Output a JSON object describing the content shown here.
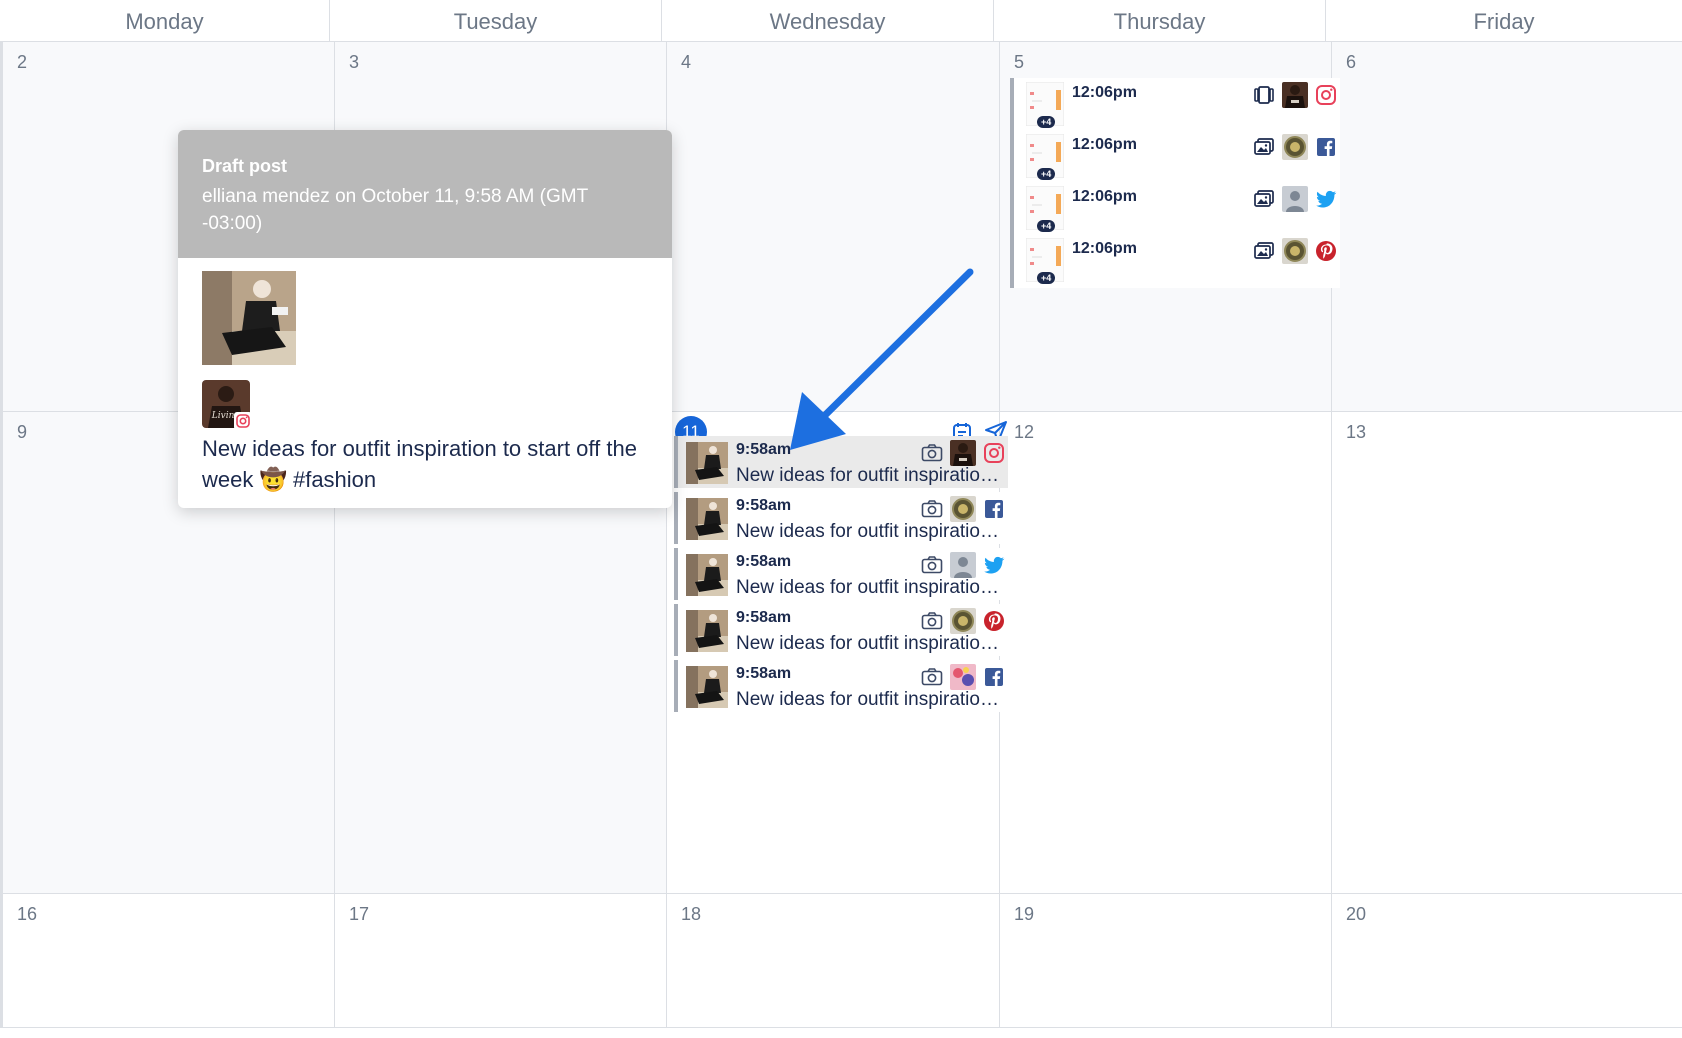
{
  "weekdays": [
    "Monday",
    "Tuesday",
    "Wednesday",
    "Thursday",
    "Friday"
  ],
  "weeks": [
    {
      "days": [
        "2",
        "3",
        "4",
        "5",
        "6"
      ]
    },
    {
      "days": [
        "9",
        "",
        "",
        "12",
        "13"
      ]
    },
    {
      "days": [
        "16",
        "17",
        "18",
        "19",
        "20"
      ]
    }
  ],
  "today": "11",
  "thursday_events": [
    {
      "time": "12:06pm",
      "badge": "+4",
      "format_icon": "carousel-icon",
      "network": "instagram"
    },
    {
      "time": "12:06pm",
      "badge": "+4",
      "format_icon": "gallery-icon",
      "network": "facebook"
    },
    {
      "time": "12:06pm",
      "badge": "+4",
      "format_icon": "gallery-icon",
      "network": "twitter"
    },
    {
      "time": "12:06pm",
      "badge": "+4",
      "format_icon": "gallery-icon",
      "network": "pinterest"
    }
  ],
  "wednesday_events": [
    {
      "time": "9:58am",
      "text": "New ideas for outfit inspiratio…",
      "format_icon": "camera-icon",
      "network": "instagram"
    },
    {
      "time": "9:58am",
      "text": "New ideas for outfit inspiratio…",
      "format_icon": "camera-icon",
      "network": "facebook"
    },
    {
      "time": "9:58am",
      "text": "New ideas for outfit inspiratio…",
      "format_icon": "camera-icon",
      "network": "twitter"
    },
    {
      "time": "9:58am",
      "text": "New ideas for outfit inspiratio…",
      "format_icon": "camera-icon",
      "network": "pinterest"
    },
    {
      "time": "9:58am",
      "text": "New ideas for outfit inspiratio…",
      "format_icon": "camera-icon",
      "network": "facebook"
    }
  ],
  "popover": {
    "title": "Draft post",
    "subtitle": "elliana mendez on October 11, 9:58 AM (GMT -03:00)",
    "text": "New ideas for outfit inspiration to start off the week 🤠 #fashion"
  },
  "colors": {
    "accent": "#1665d8",
    "instagram": "#e8415a",
    "facebook": "#3b5998",
    "twitter": "#1da1f2",
    "pinterest": "#c8232c"
  }
}
